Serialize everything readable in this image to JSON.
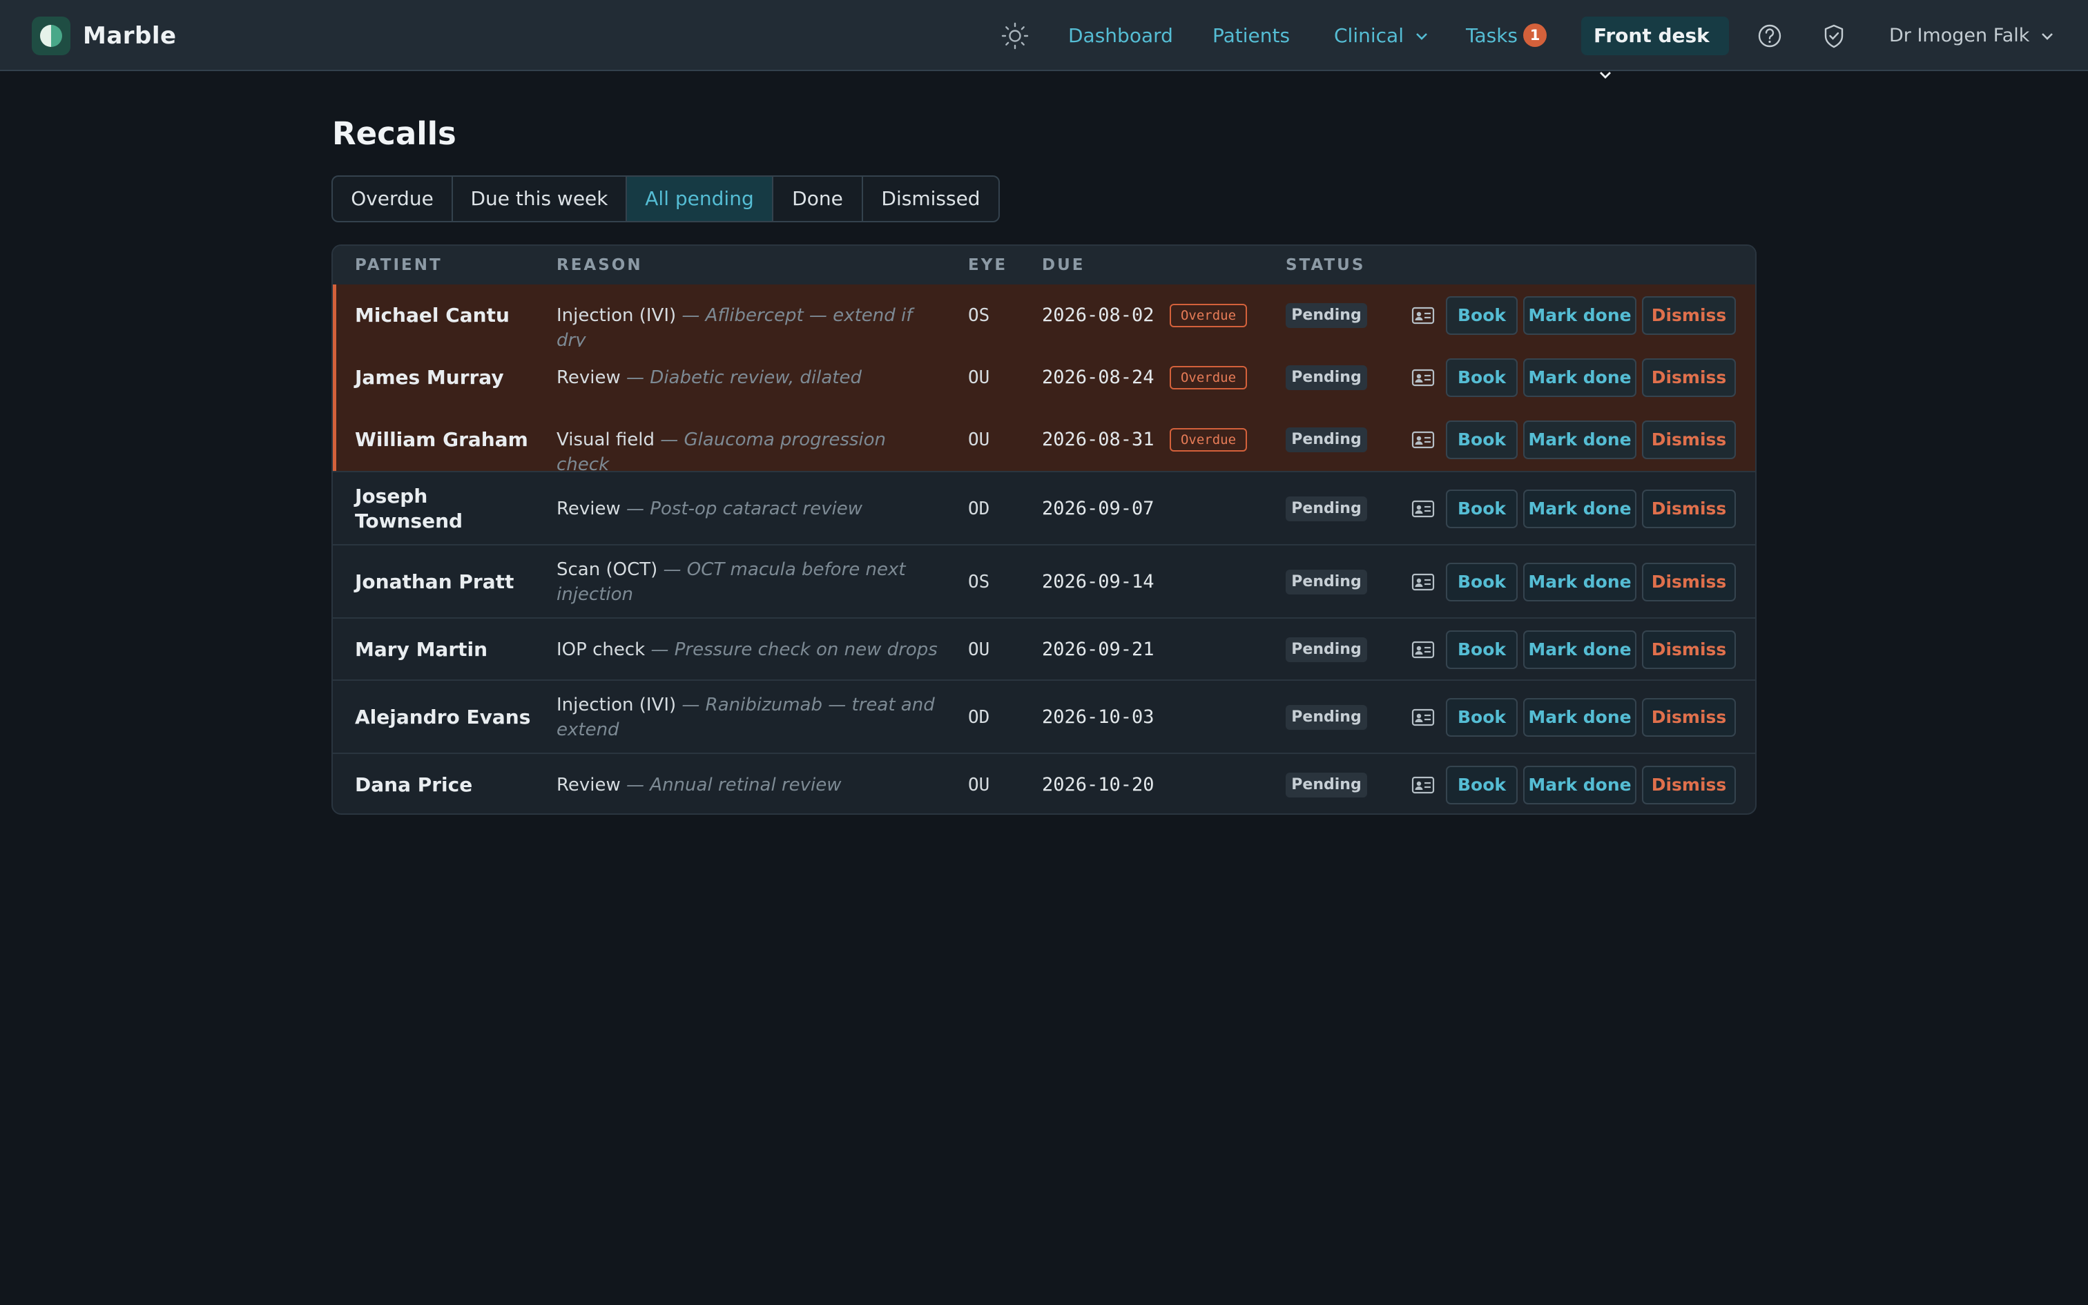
{
  "app": {
    "name": "Marble"
  },
  "nav": {
    "dashboard": "Dashboard",
    "patients": "Patients",
    "clinical": "Clinical",
    "tasks": "Tasks",
    "tasks_count": "1",
    "role": "Front desk",
    "user": "Dr Imogen Falk"
  },
  "page": {
    "title": "Recalls"
  },
  "tabs": [
    "Overdue",
    "Due this week",
    "All pending",
    "Done",
    "Dismissed"
  ],
  "active_tab": "All pending",
  "table": {
    "headers": {
      "patient": "PATIENT",
      "reason": "REASON",
      "eye": "EYE",
      "due": "DUE",
      "status": "STATUS"
    },
    "overdue_label": "Overdue",
    "actions": {
      "book": "Book",
      "done": "Mark done",
      "dismiss": "Dismiss"
    },
    "rows": [
      {
        "patient": "Michael Cantu",
        "reason": "Injection (IVI)",
        "note": "— Aflibercept — extend if dry",
        "eye": "OS",
        "due": "2026-08-02",
        "overdue": true,
        "status": "Pending"
      },
      {
        "patient": "James Murray",
        "reason": "Review",
        "note": "— Diabetic review, dilated",
        "eye": "OU",
        "due": "2026-08-24",
        "overdue": true,
        "status": "Pending"
      },
      {
        "patient": "William Graham",
        "reason": "Visual field",
        "note": "— Glaucoma progression check",
        "eye": "OU",
        "due": "2026-08-31",
        "overdue": true,
        "status": "Pending"
      },
      {
        "patient": "Joseph Townsend",
        "reason": "Review",
        "note": "— Post-op cataract review",
        "eye": "OD",
        "due": "2026-09-07",
        "overdue": false,
        "status": "Pending"
      },
      {
        "patient": "Jonathan Pratt",
        "reason": "Scan (OCT)",
        "note": "— OCT macula before next injection",
        "eye": "OS",
        "due": "2026-09-14",
        "overdue": false,
        "status": "Pending"
      },
      {
        "patient": "Mary Martin",
        "reason": "IOP check",
        "note": "— Pressure check on new drops",
        "eye": "OU",
        "due": "2026-09-21",
        "overdue": false,
        "status": "Pending"
      },
      {
        "patient": "Alejandro Evans",
        "reason": "Injection (IVI)",
        "note": "— Ranibizumab — treat and extend",
        "eye": "OD",
        "due": "2026-10-03",
        "overdue": false,
        "status": "Pending"
      },
      {
        "patient": "Dana Price",
        "reason": "Review",
        "note": "— Annual retinal review",
        "eye": "OU",
        "due": "2026-10-20",
        "overdue": false,
        "status": "Pending"
      }
    ]
  },
  "colors": {
    "accent": "#55bdd4",
    "danger": "#d4613b",
    "background": "#11161c"
  }
}
